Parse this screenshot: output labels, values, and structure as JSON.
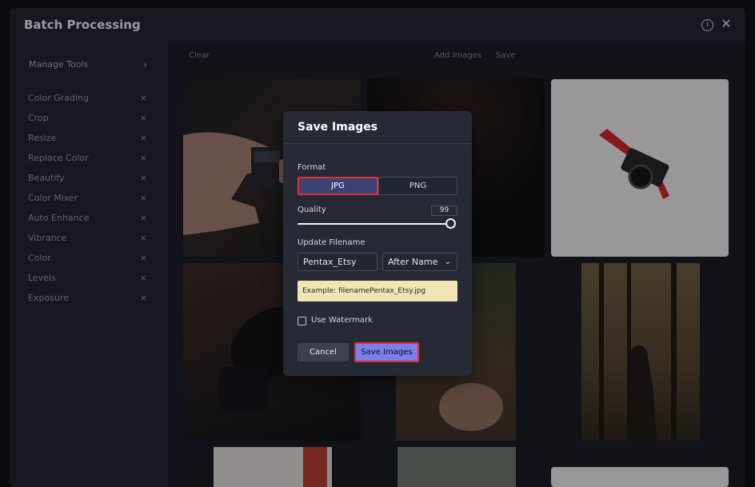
{
  "window": {
    "title": "Batch Processing"
  },
  "sidebar": {
    "manage_tools": "Manage Tools",
    "tools": [
      {
        "label": "Color Grading"
      },
      {
        "label": "Crop"
      },
      {
        "label": "Resize"
      },
      {
        "label": "Replace Color"
      },
      {
        "label": "Beautify"
      },
      {
        "label": "Color Mixer"
      },
      {
        "label": "Auto Enhance"
      },
      {
        "label": "Vibrance"
      },
      {
        "label": "Color"
      },
      {
        "label": "Levels"
      },
      {
        "label": "Exposure"
      }
    ],
    "remove_glyph": "×",
    "chevron_glyph": "›"
  },
  "toolbar": {
    "clear": "Clear",
    "add_images": "Add Images",
    "save": "Save"
  },
  "dialog": {
    "title": "Save Images",
    "format_label": "Format",
    "formats": [
      "JPG",
      "PNG"
    ],
    "selected_format": "JPG",
    "quality_label": "Quality",
    "quality_value": "99",
    "filename_label": "Update Filename",
    "filename_value": "Pentax_Etsy",
    "position_value": "After Name",
    "example_text": "Example: filenamePentax_Etsy.jpg",
    "watermark_label": "Use Watermark",
    "watermark_checked": false,
    "cancel_label": "Cancel",
    "save_label": "Save Images"
  },
  "colors": {
    "accent": "#7a7fea",
    "highlight_border": "#e23030",
    "example_bg": "#f1e4b5"
  }
}
